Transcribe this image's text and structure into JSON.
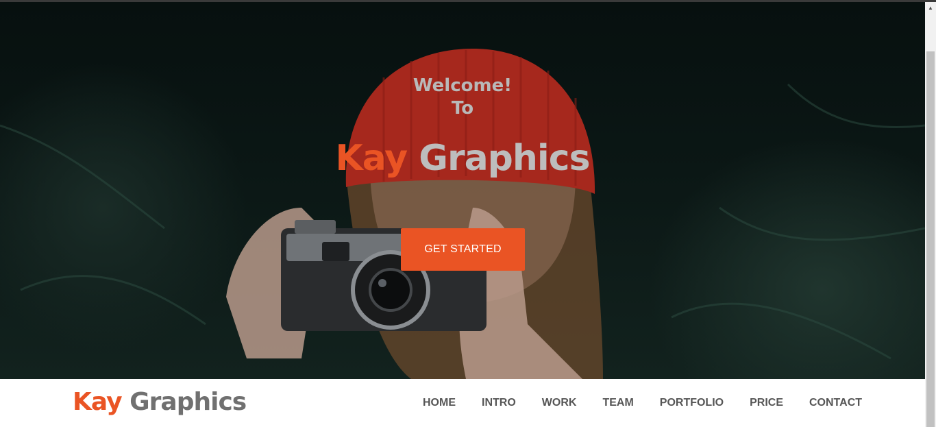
{
  "hero": {
    "welcome_line1": "Welcome!",
    "welcome_line2": "To",
    "title_accent": "Kay",
    "title_rest": "Graphics",
    "cta_label": "GET STARTED"
  },
  "navbar": {
    "brand_accent": "Kay",
    "brand_rest": "Graphics",
    "items": [
      {
        "label": "HOME"
      },
      {
        "label": "INTRO"
      },
      {
        "label": "WORK"
      },
      {
        "label": "TEAM"
      },
      {
        "label": "PORTFOLIO"
      },
      {
        "label": "PRICE"
      },
      {
        "label": "CONTACT"
      }
    ]
  },
  "colors": {
    "accent": "#ea5424",
    "title_gray": "#bdbdbd",
    "nav_text": "#555555",
    "hero_dark": "#0b1715"
  },
  "icons": {
    "scroll_up": "triangle-up-icon"
  }
}
